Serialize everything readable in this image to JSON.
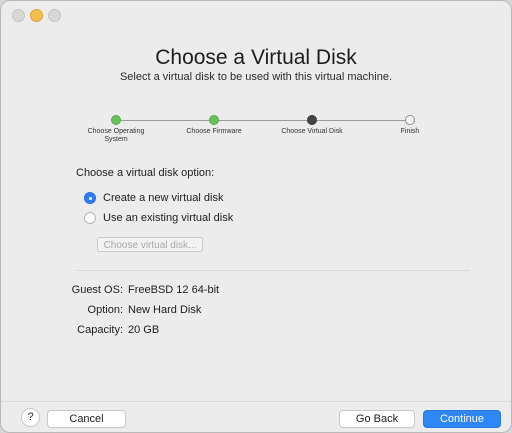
{
  "window": {
    "title": "Choose a Virtual Disk",
    "subtitle": "Select a virtual disk to be used with this virtual machine."
  },
  "stepper": {
    "steps": [
      {
        "label": "Choose Operating System",
        "state": "done"
      },
      {
        "label": "Choose Firmware",
        "state": "done"
      },
      {
        "label": "Choose Virtual Disk",
        "state": "current"
      },
      {
        "label": "Finish",
        "state": "todo"
      }
    ]
  },
  "disk_option": {
    "title": "Choose a virtual disk option:",
    "options": [
      {
        "label": "Create a new virtual disk",
        "selected": true
      },
      {
        "label": "Use an existing virtual disk",
        "selected": false
      }
    ],
    "choose_button": "Choose virtual disk..."
  },
  "summary": {
    "guest_os_label": "Guest OS:",
    "guest_os_value": "FreeBSD 12 64-bit",
    "option_label": "Option:",
    "option_value": "New Hard Disk",
    "capacity_label": "Capacity:",
    "capacity_value": "20 GB"
  },
  "footer": {
    "help": "?",
    "cancel": "Cancel",
    "go_back": "Go Back",
    "continue": "Continue"
  },
  "colors": {
    "accent": "#2f86f6",
    "step_done": "#6ac15a",
    "step_current": "#444444"
  }
}
